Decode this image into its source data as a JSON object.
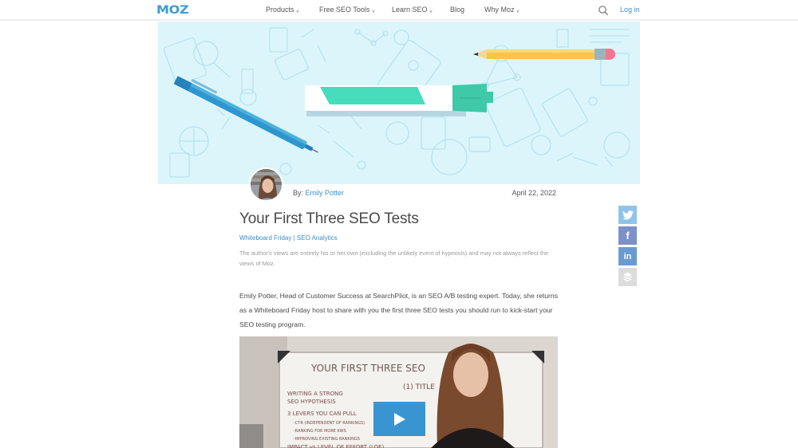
{
  "header": {
    "logo": "MOZ",
    "nav": [
      {
        "label": "Products",
        "dropdown": true
      },
      {
        "label": "Free SEO Tools",
        "dropdown": true
      },
      {
        "label": "Learn SEO",
        "dropdown": true
      },
      {
        "label": "Blog",
        "dropdown": false
      },
      {
        "label": "Why Moz",
        "dropdown": true
      }
    ],
    "search_icon": "search-icon",
    "login_label": "Log in"
  },
  "hero": {
    "illustration": "whiteboard-marker-pen-pencil-doodles"
  },
  "article": {
    "by_prefix": "By:",
    "author": "Emily Potter",
    "date": "April 22, 2022",
    "title": "Your First Three SEO Tests",
    "categories": [
      "Whiteboard Friday",
      "SEO Analytics"
    ],
    "category_separator": "|",
    "disclaimer": "The author's views are entirely his or her own (excluding the unlikely event of hypnosis) and may not always reflect the views of Moz.",
    "intro": "Emily Potter, Head of Customer Success at SearchPilot, is an SEO A/B testing expert. Today, she returns as a Whiteboard Friday host to share with you the first three SEO tests you should run to kick-start your SEO testing program."
  },
  "video": {
    "whiteboard_title": "YOUR FIRST THREE SEO",
    "whiteboard_lines": [
      "WRITING A STRONG",
      "SEO HYPOTHESIS",
      "3 LEVERS YOU CAN PULL",
      "-CTR (INDEPENDENT OF RANKINGS)",
      "-RANKING FOR MORE KWS",
      "-IMPROVING EXISTING RANKINGS",
      "IMPACT vs LEVEL OF EFFORT (LOE)"
    ],
    "whiteboard_right": "(1) TITLE",
    "play_icon": "play-icon"
  },
  "social": [
    {
      "name": "twitter",
      "icon": "twitter-icon"
    },
    {
      "name": "facebook",
      "icon": "facebook-icon",
      "glyph": "f"
    },
    {
      "name": "linkedin",
      "icon": "linkedin-icon",
      "glyph": "in"
    },
    {
      "name": "buffer",
      "icon": "buffer-icon"
    }
  ],
  "colors": {
    "brand_blue": "#3d9bd6",
    "link": "#3d8ec8",
    "hero_bg": "#dcf5fb",
    "twitter": "#8fc4ea",
    "facebook": "#7d91c9",
    "linkedin": "#6a9bd0",
    "buffer": "#dcdcdc",
    "play_button": "#2f8fd1"
  }
}
